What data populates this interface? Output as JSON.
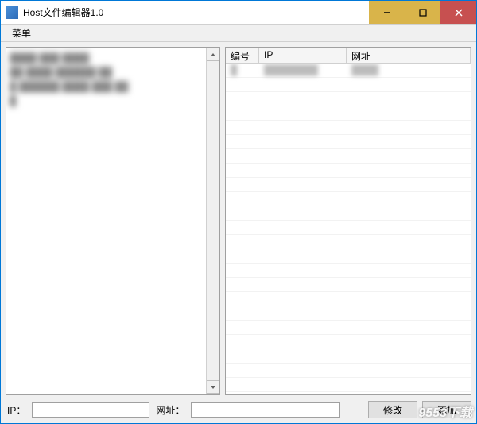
{
  "window": {
    "title": "Host文件编辑器1.0"
  },
  "menubar": {
    "menu1": "菜单"
  },
  "columns": {
    "col1": "编号",
    "col2": "IP",
    "col3": "网址"
  },
  "bottom": {
    "ip_label": "IP：",
    "ip_value": "",
    "url_label": "网址：",
    "url_value": "",
    "modify_label": "修改",
    "add_label": "添加"
  },
  "watermark": "9553下载"
}
